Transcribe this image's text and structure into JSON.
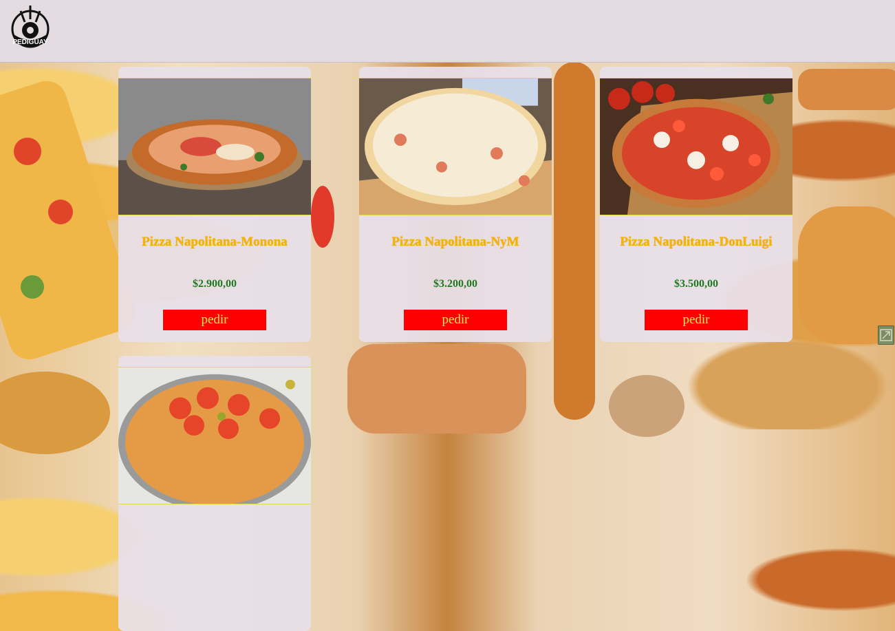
{
  "header": {
    "logo_text": "PEDIGUAY"
  },
  "products": [
    {
      "title": "Pizza Napolitana-Monona",
      "price": "$2.900,00",
      "button": "pedir"
    },
    {
      "title": "Pizza Napolitana-NyM",
      "price": "$3.200,00",
      "button": "pedir"
    },
    {
      "title": "Pizza Napolitana-DonLuigi",
      "price": "$3.500,00",
      "button": "pedir"
    },
    {
      "title": "",
      "price": "",
      "button": ""
    }
  ],
  "colors": {
    "header_bg": "#e3dbe0",
    "card_bg": "#e8dfe8",
    "title": "#f5b400",
    "price": "#1e7a1e",
    "button_bg": "#ff0000",
    "button_text": "#ffe94a"
  }
}
